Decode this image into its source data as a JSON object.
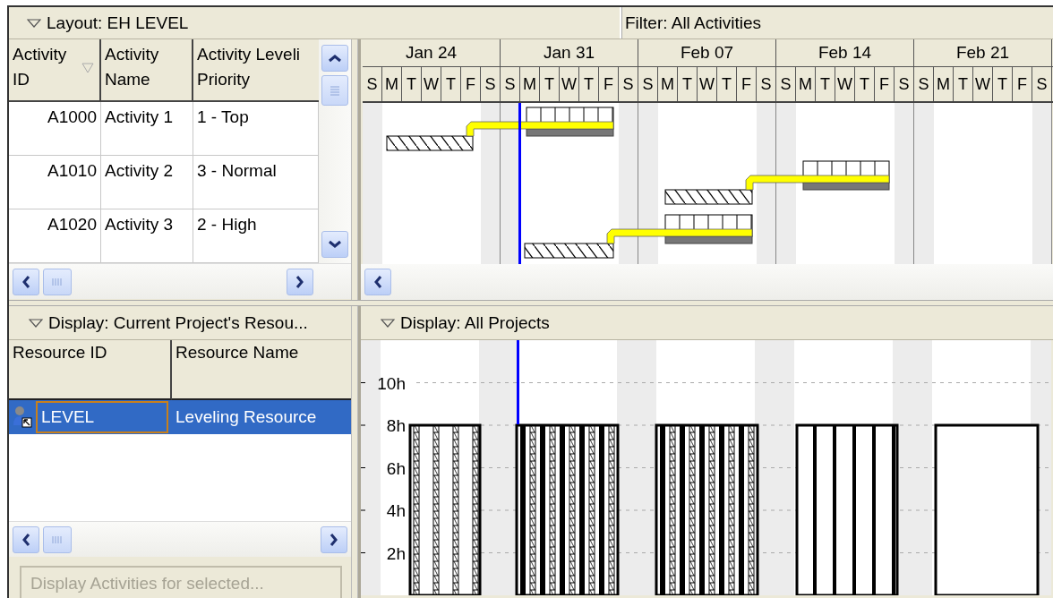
{
  "layout_bar": {
    "title": "Layout: EH LEVEL",
    "filter": "Filter: All Activities"
  },
  "activities": {
    "columns": [
      "Activity ID",
      "Activity Name",
      "Activity Leveli Priority"
    ],
    "rows": [
      {
        "id": "A1000",
        "name": "Activity 1",
        "priority": "1 - Top"
      },
      {
        "id": "A1010",
        "name": "Activity 2",
        "priority": "3 - Normal"
      },
      {
        "id": "A1020",
        "name": "Activity 3",
        "priority": "2 - High"
      }
    ]
  },
  "gantt": {
    "weeks": [
      {
        "label": "Jan 24",
        "days": [
          "S",
          "M",
          "T",
          "W",
          "T",
          "F",
          "S"
        ]
      },
      {
        "label": "Jan 31",
        "days": [
          "S",
          "M",
          "T",
          "W",
          "T",
          "F",
          "S"
        ]
      },
      {
        "label": "Feb 07",
        "days": [
          "S",
          "M",
          "T",
          "W",
          "T",
          "F",
          "S"
        ]
      },
      {
        "label": "Feb 14",
        "days": [
          "S",
          "M",
          "T",
          "W",
          "T",
          "F",
          "S"
        ]
      },
      {
        "label": "Feb 21",
        "days": [
          "S",
          "M",
          "T",
          "W",
          "T",
          "F",
          "S"
        ]
      }
    ]
  },
  "resources": {
    "title": "Display: Current Project's Resou...",
    "columns": [
      "Resource ID",
      "Resource Name"
    ],
    "rows": [
      {
        "id": "LEVEL",
        "name": "Leveling Resource",
        "selected": true
      }
    ],
    "button": {
      "label": "Display Activities for selected...",
      "disabled": true
    }
  },
  "histogram": {
    "title": "Display: All Projects",
    "chart_data": {
      "type": "bar",
      "values": [
        8,
        8,
        8,
        8,
        8
      ],
      "ylim": [
        0,
        12
      ],
      "grid": true,
      "yticks": [
        {
          "value": 2,
          "label": "2h"
        },
        {
          "value": 4,
          "label": "4h"
        },
        {
          "value": 6,
          "label": "6h"
        },
        {
          "value": 8,
          "label": "8h"
        },
        {
          "value": 10,
          "label": "10h"
        }
      ]
    }
  }
}
